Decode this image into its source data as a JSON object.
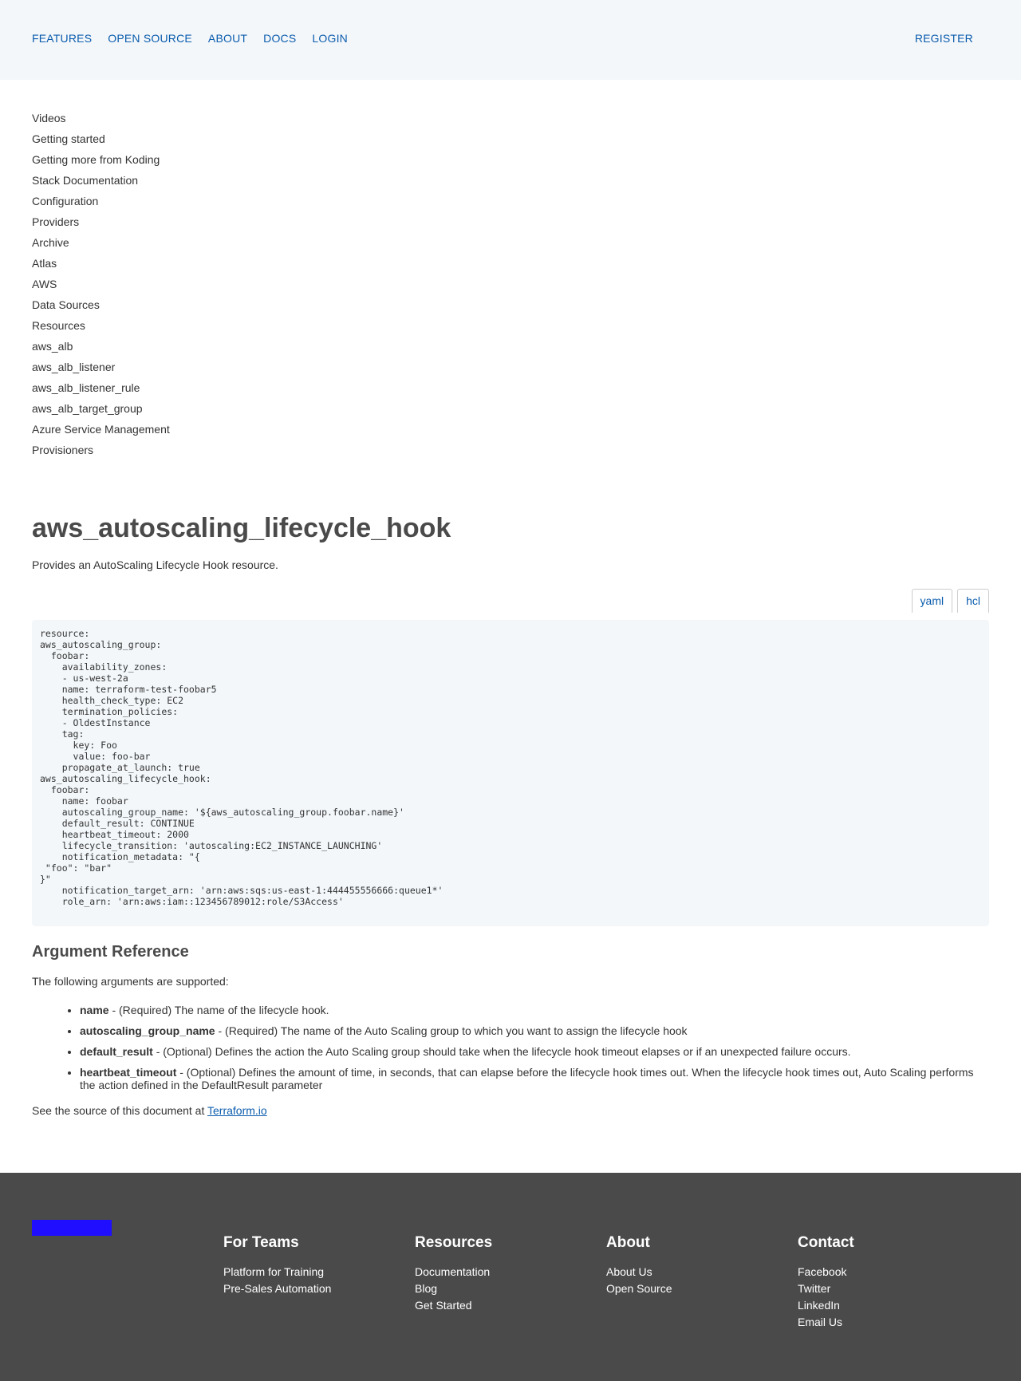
{
  "header": {
    "nav": [
      "FEATURES",
      "OPEN SOURCE",
      "ABOUT",
      "DOCS",
      "LOGIN"
    ],
    "register": "REGISTER"
  },
  "sidebar": {
    "items": [
      "Videos",
      "Getting started",
      "Getting more from Koding",
      "Stack Documentation",
      "Configuration",
      "Providers",
      "Archive",
      "Atlas",
      "AWS",
      "Data Sources",
      "Resources",
      "aws_alb",
      "aws_alb_listener",
      "aws_alb_listener_rule",
      "aws_alb_target_group",
      "Azure Service Management",
      "Provisioners"
    ]
  },
  "main": {
    "title": "aws_autoscaling_lifecycle_hook",
    "intro": "Provides an AutoScaling Lifecycle Hook resource.",
    "tabs": [
      "yaml",
      "hcl"
    ],
    "code": "resource:\naws_autoscaling_group:\n  foobar:\n    availability_zones:\n    - us-west-2a\n    name: terraform-test-foobar5\n    health_check_type: EC2\n    termination_policies:\n    - OldestInstance\n    tag:\n      key: Foo\n      value: foo-bar\n    propagate_at_launch: true\naws_autoscaling_lifecycle_hook:\n  foobar:\n    name: foobar\n    autoscaling_group_name: '${aws_autoscaling_group.foobar.name}'\n    default_result: CONTINUE\n    heartbeat_timeout: 2000\n    lifecycle_transition: 'autoscaling:EC2_INSTANCE_LAUNCHING'\n    notification_metadata: \"{\n \"foo\": \"bar\"\n}\"\n    notification_target_arn: 'arn:aws:sqs:us-east-1:444455556666:queue1*'\n    role_arn: 'arn:aws:iam::123456789012:role/S3Access'",
    "arguments": {
      "heading": "Argument Reference",
      "lead": "The following arguments are supported:",
      "items": [
        {
          "name": "name",
          "desc": " - (Required) The name of the lifecycle hook."
        },
        {
          "name": "autoscaling_group_name",
          "desc": " - (Required) The name of the Auto Scaling group to which you want to assign the lifecycle hook"
        },
        {
          "name": "default_result",
          "desc": " - (Optional) Defines the action the Auto Scaling group should take when the lifecycle hook timeout elapses or if an unexpected failure occurs."
        },
        {
          "name": "heartbeat_timeout",
          "desc": " - (Optional) Defines the amount of time, in seconds, that can elapse before the lifecycle hook times out. When the lifecycle hook times out, Auto Scaling performs the action defined in the DefaultResult parameter"
        }
      ]
    },
    "source_prefix": "See the source of this document at ",
    "source_link": "Terraform.io"
  },
  "footer": {
    "columns": [
      {
        "title": "For Teams",
        "links": [
          "Platform for Training",
          "Pre-Sales Automation"
        ]
      },
      {
        "title": "Resources",
        "links": [
          "Documentation",
          "Blog",
          "Get Started"
        ]
      },
      {
        "title": "About",
        "links": [
          "About Us",
          "Open Source"
        ]
      },
      {
        "title": "Contact",
        "links": [
          "Facebook",
          "Twitter",
          "LinkedIn",
          "Email Us"
        ]
      }
    ]
  },
  "colors": {
    "link": "#0b5cad",
    "header_bg": "#f3f7fa",
    "footer_bg": "#4a4a4a",
    "logo": "#1f0eff"
  }
}
